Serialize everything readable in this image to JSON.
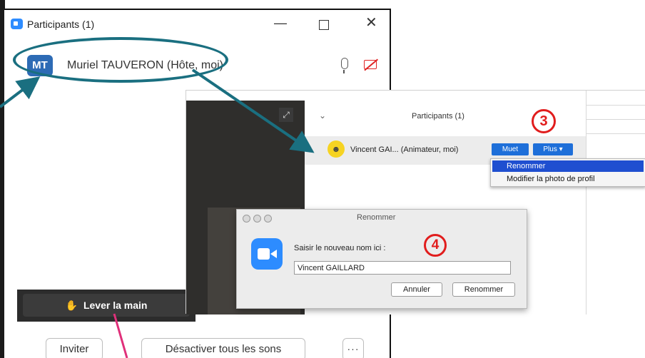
{
  "windows_participants": {
    "title": "Participants (1)",
    "host": {
      "initials": "MT",
      "name": "Muriel TAUVERON (Hôte, moi)"
    },
    "raise_hand": {
      "icon": "✋",
      "label": "Lever la main"
    },
    "buttons": {
      "invite": "Inviter",
      "mute_all": "Désactiver tous les sons",
      "more": "···"
    },
    "controls": {
      "minimize": "—",
      "close": "✕"
    }
  },
  "mac_panel": {
    "title": "Participants (1)",
    "participant": {
      "name": "Vincent GAI...",
      "role": "(Animateur, moi)"
    },
    "buttons": {
      "mute": "Muet",
      "more": "Plus ▾"
    },
    "badge_step3": "3",
    "menu": {
      "rename": "Renommer",
      "change_photo": "Modifier la photo de profil"
    },
    "dialog": {
      "title": "Renommer",
      "prompt": "Saisir le nouveau nom ici :",
      "input_value": "Vincent GAILLARD",
      "cancel": "Annuler",
      "rename": "Renommer",
      "badge_step4": "4"
    }
  },
  "colors": {
    "annotation_teal": "#1a6f80",
    "annotation_red": "#e11d1d",
    "annotation_pink": "#e0307a",
    "zoom_blue": "#2d8cff"
  }
}
